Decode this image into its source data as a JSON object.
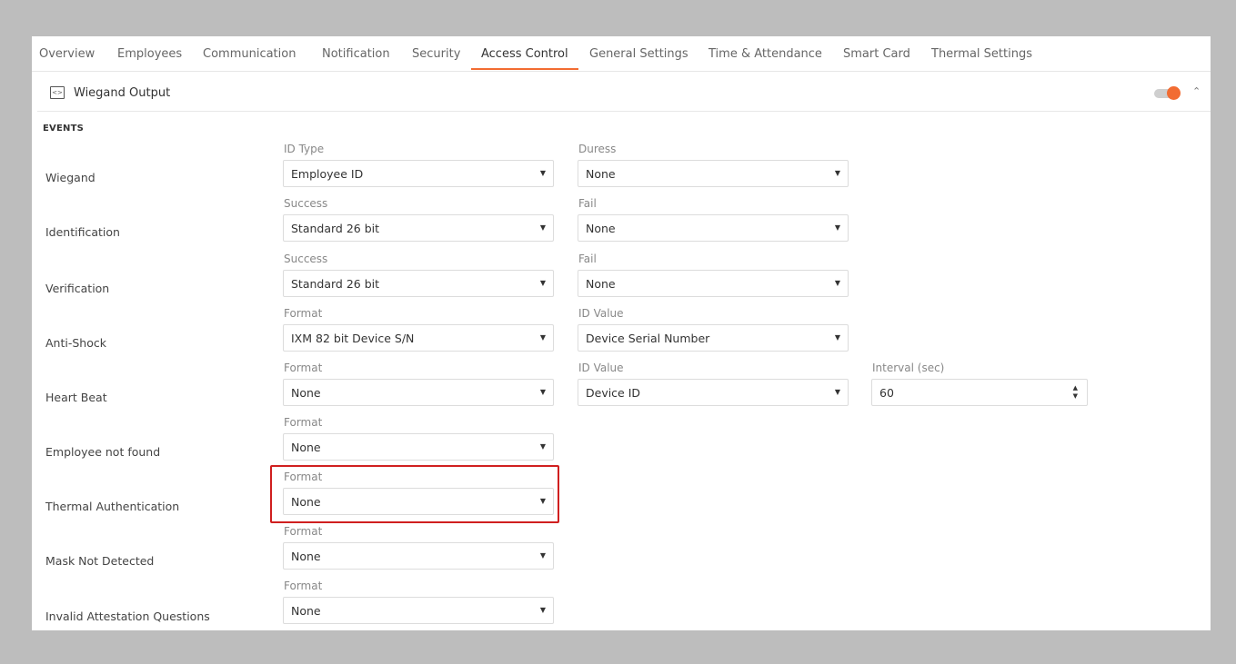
{
  "tabs": [
    "Overview",
    "Employees",
    "Communication",
    "Notification",
    "Security",
    "Access Control",
    "General Settings",
    "Time & Attendance",
    "Smart Card",
    "Thermal Settings"
  ],
  "active_tab": "Access Control",
  "section": {
    "title": "Wiegand Output",
    "icon": "code-card-icon",
    "toggle_on": true,
    "accent": "#f26c32"
  },
  "events_heading": "EVENTS",
  "rows": [
    {
      "label": "Wiegand",
      "f1_label": "ID Type",
      "f1_value": "Employee ID",
      "f2_label": "Duress",
      "f2_value": "None"
    },
    {
      "label": "Identification",
      "f1_label": "Success",
      "f1_value": "Standard 26 bit",
      "f2_label": "Fail",
      "f2_value": "None"
    },
    {
      "label": "Verification",
      "f1_label": "Success",
      "f1_value": "Standard 26 bit",
      "f2_label": "Fail",
      "f2_value": "None"
    },
    {
      "label": "Anti-Shock",
      "f1_label": "Format",
      "f1_value": "IXM 82 bit Device S/N",
      "f2_label": "ID Value",
      "f2_value": "Device Serial Number"
    },
    {
      "label": "Heart Beat",
      "f1_label": "Format",
      "f1_value": "None",
      "f2_label": "ID Value",
      "f2_value": "Device ID",
      "f3_label": "Interval (sec)",
      "f3_value": "60"
    },
    {
      "label": "Employee not found",
      "f1_label": "Format",
      "f1_value": "None"
    },
    {
      "label": "Thermal Authentication",
      "f1_label": "Format",
      "f1_value": "None"
    },
    {
      "label": "Mask Not Detected",
      "f1_label": "Format",
      "f1_value": "None"
    },
    {
      "label": "Invalid Attestation Questions",
      "f1_label": "Format",
      "f1_value": "None"
    }
  ],
  "highlight_color": "#d01f1f"
}
